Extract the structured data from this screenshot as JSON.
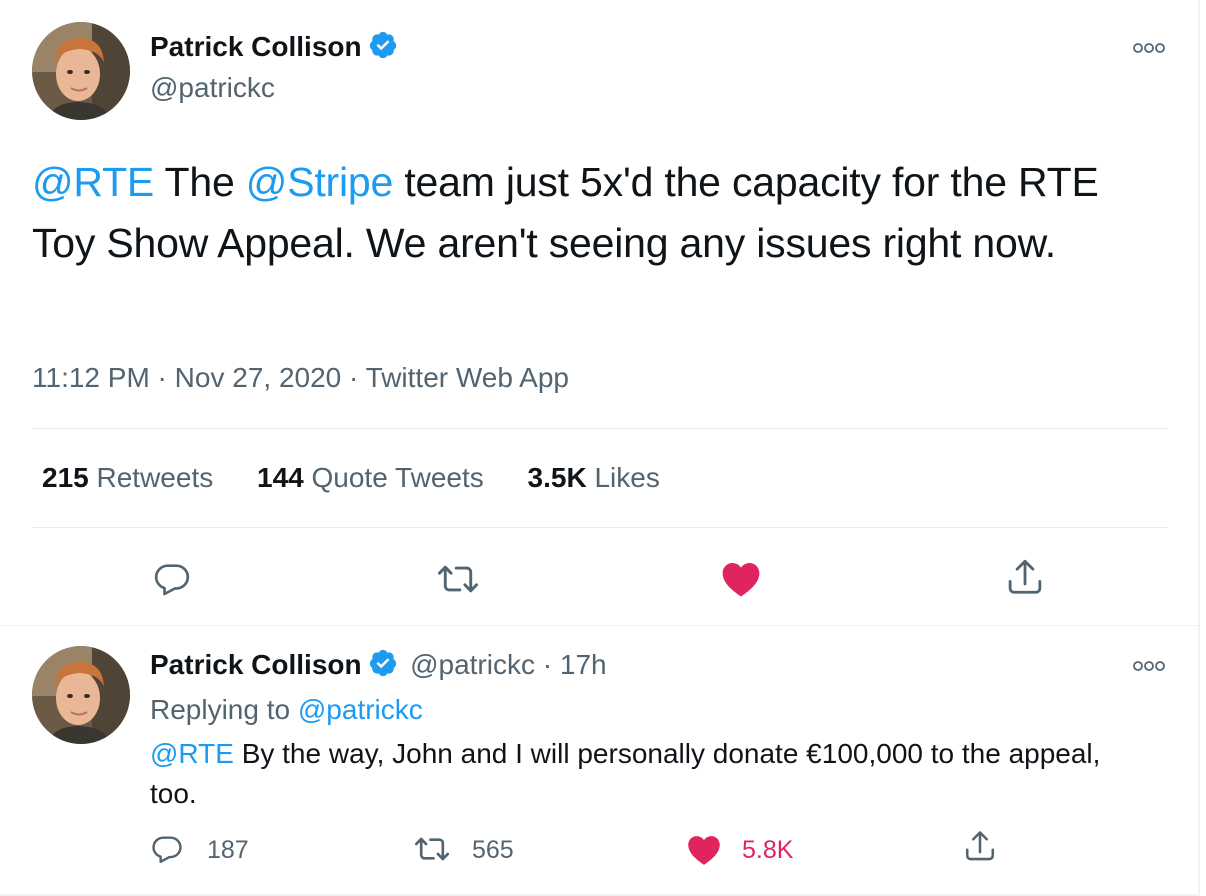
{
  "main_tweet": {
    "author_name": "Patrick Collison",
    "author_handle": "@patrickc",
    "text_mention_1": "@RTE",
    "text_part_1": " The ",
    "text_mention_2": "@Stripe",
    "text_part_2": " team just 5x'd the capacity for the RTE Toy Show Appeal. We aren't seeing any issues right now.",
    "time": "11:12 PM",
    "date": "Nov 27, 2020",
    "source": "Twitter Web App",
    "separator": " · ",
    "stats": {
      "retweets_count": "215",
      "retweets_label": "Retweets",
      "quotes_count": "144",
      "quotes_label": "Quote Tweets",
      "likes_count": "3.5K",
      "likes_label": "Likes"
    },
    "liked": true
  },
  "reply_tweet": {
    "author_name": "Patrick Collison",
    "author_handle": "@patrickc",
    "time_ago": "17h",
    "separator": " · ",
    "replying_label": "Replying to ",
    "replying_to": "@patrickc",
    "text_mention": "@RTE",
    "text_body": " By the way, John and I will personally donate €100,000 to the appeal, too.",
    "reply_count": "187",
    "retweet_count": "565",
    "like_count": "5.8K",
    "liked": true
  },
  "colors": {
    "accent": "#1d9bf0",
    "like": "#e0245e",
    "secondary_text": "#536471",
    "verified": "#1d9bf0"
  },
  "icons": [
    "verified-badge-icon",
    "more-options-icon",
    "reply-icon",
    "retweet-icon",
    "like-icon",
    "share-icon"
  ]
}
